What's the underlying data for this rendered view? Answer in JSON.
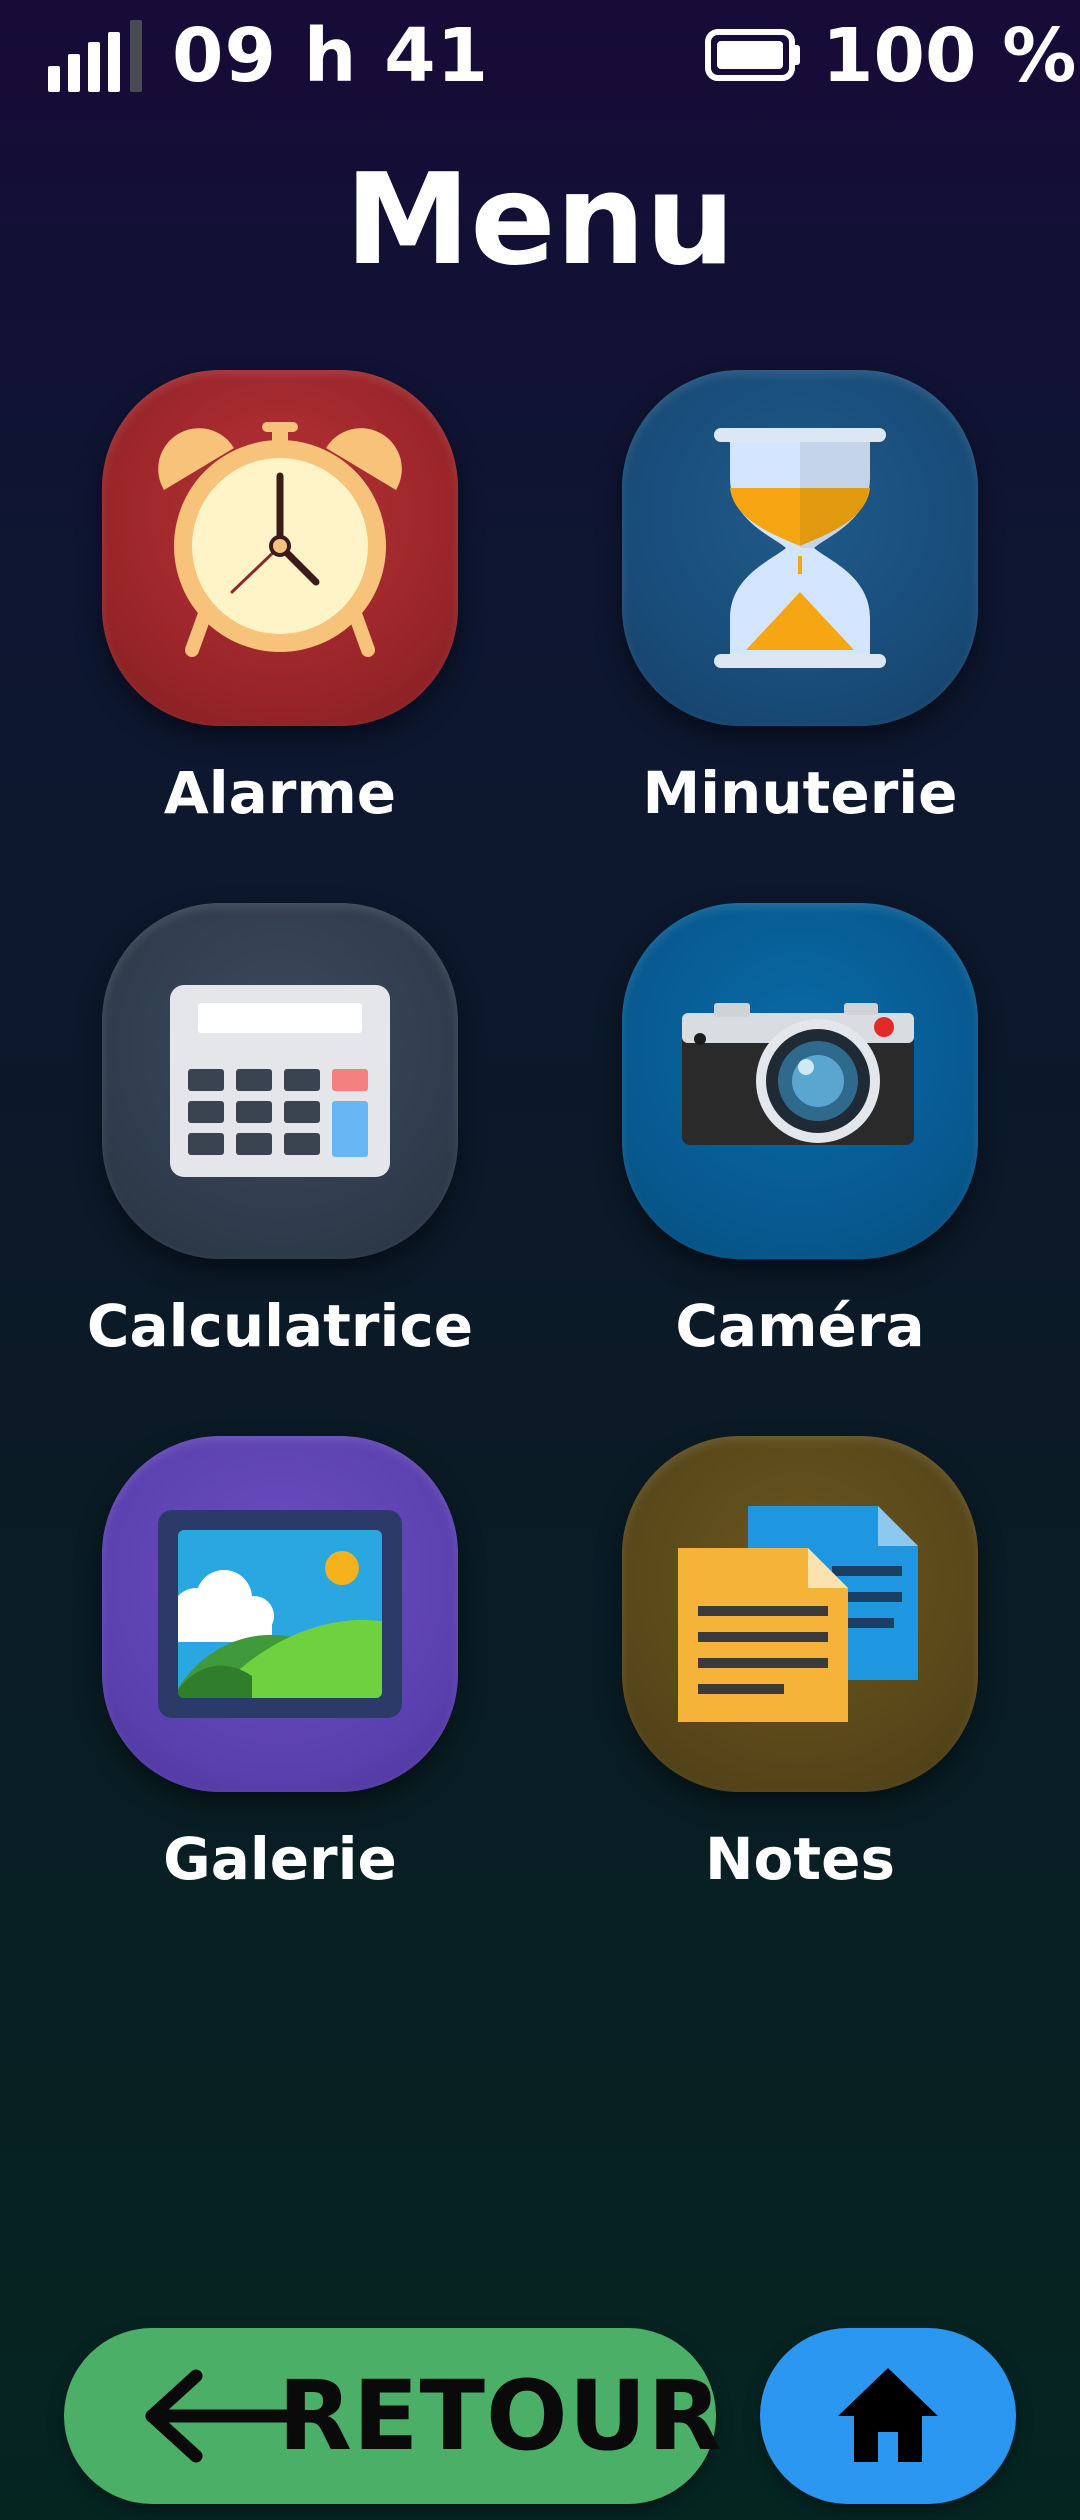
{
  "status_bar": {
    "time": "09 h 41",
    "battery_level": "100 %",
    "signal_bars_filled": 4,
    "signal_bars_total": 5,
    "battery_fill": 1.0
  },
  "page": {
    "title": "Menu"
  },
  "apps": {
    "alarme": {
      "label": "Alarme",
      "icon": "alarm-clock-icon"
    },
    "minuterie": {
      "label": "Minuterie",
      "icon": "hourglass-icon"
    },
    "calculatrice": {
      "label": "Calculatrice",
      "icon": "calculator-icon"
    },
    "camera": {
      "label": "Caméra",
      "icon": "camera-icon"
    },
    "galerie": {
      "label": "Galerie",
      "icon": "picture-icon"
    },
    "notes": {
      "label": "Notes",
      "icon": "notes-icon"
    }
  },
  "nav": {
    "back_label": "RETOUR",
    "back_icon": "arrow-left-icon",
    "home_icon": "home-icon"
  },
  "colors": {
    "back_button": "#4caf67",
    "home_button": "#2b97f0",
    "alarme_tile": "#962428",
    "minuterie_tile": "#184a76",
    "calculatrice_tile": "#2f3b4b",
    "camera_tile": "#07588e",
    "galerie_tile": "#5a3fae",
    "notes_tile": "#574619"
  }
}
